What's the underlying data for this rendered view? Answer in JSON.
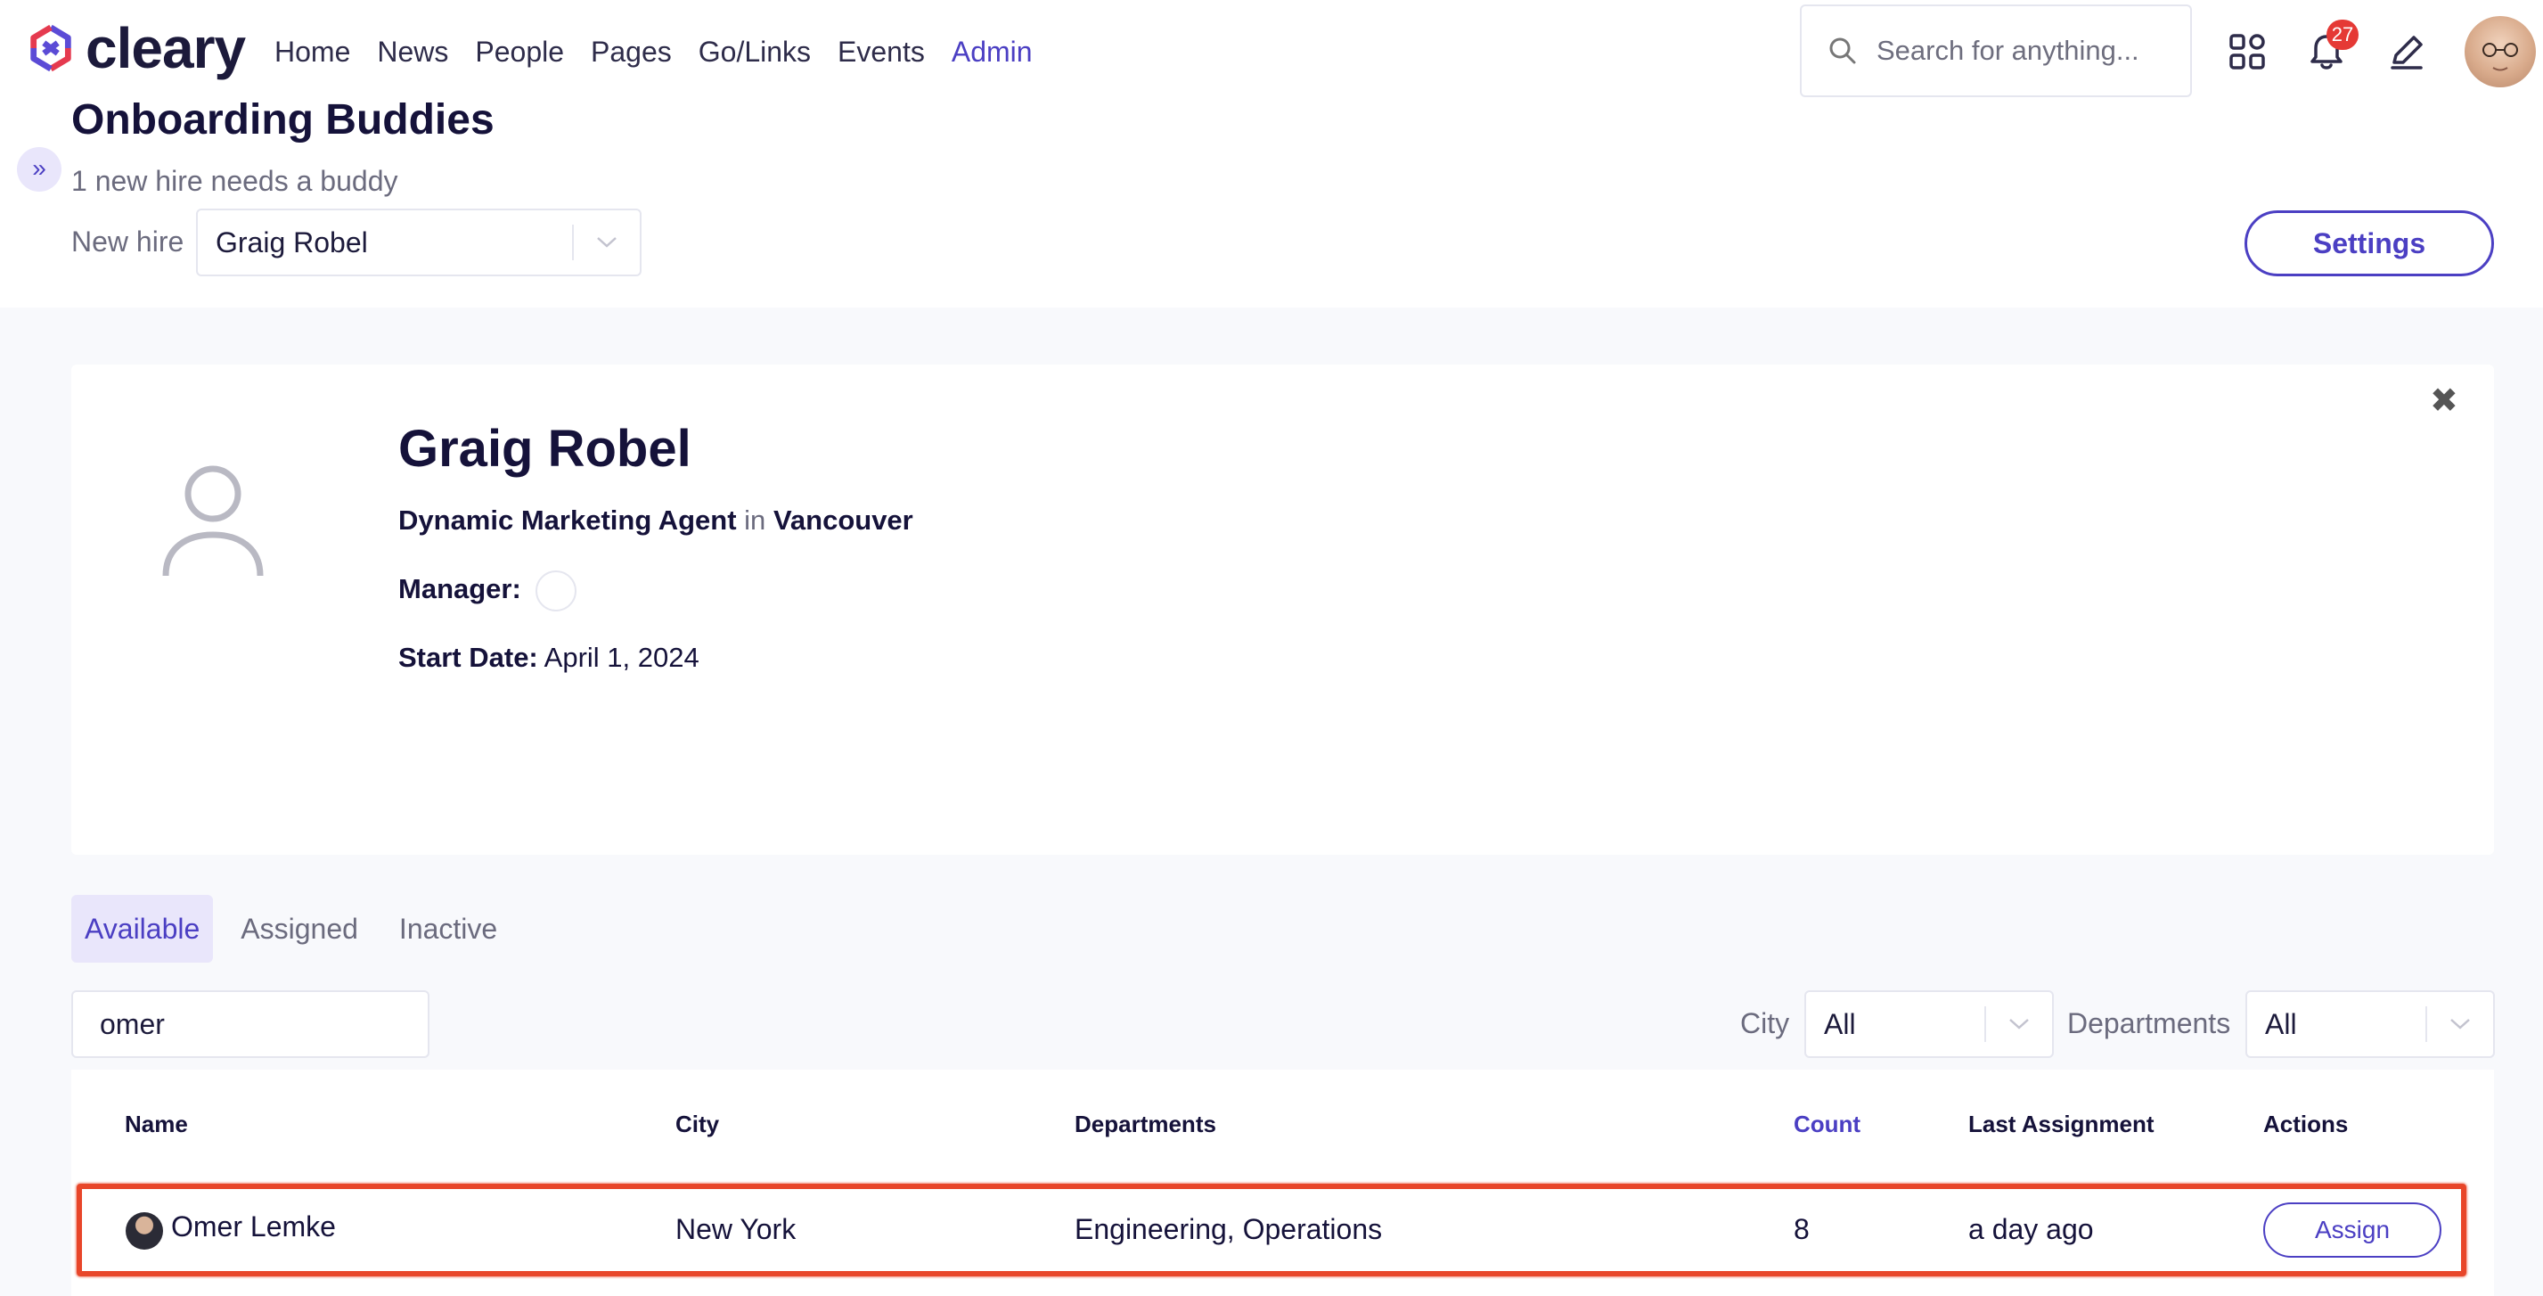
{
  "app": {
    "logo_text": "cleary"
  },
  "nav": {
    "items": [
      "Home",
      "News",
      "People",
      "Pages",
      "Go/Links",
      "Events",
      "Admin"
    ],
    "active": "Admin"
  },
  "header": {
    "search_placeholder": "Search for anything...",
    "notification_count": "27",
    "icons": [
      "apps-grid-icon",
      "bell-icon",
      "pencil-icon",
      "user-avatar"
    ]
  },
  "page": {
    "title": "Onboarding Buddies",
    "subtitle": "1 new hire needs a buddy",
    "new_hire_label": "New hire",
    "new_hire_selected": "Graig Robel",
    "settings_label": "Settings"
  },
  "new_hire": {
    "name": "Graig Robel",
    "title": "Dynamic Marketing Agent",
    "in_word": "in",
    "location": "Vancouver",
    "manager_label": "Manager:",
    "start_date_label": "Start Date:",
    "start_date": "April 1, 2024",
    "close_glyph": "✖"
  },
  "tabs": {
    "items": [
      "Available",
      "Assigned",
      "Inactive"
    ],
    "active": "Available"
  },
  "filters": {
    "search_value": "omer",
    "city_label": "City",
    "city_value": "All",
    "departments_label": "Departments",
    "departments_value": "All"
  },
  "table": {
    "headers": {
      "name": "Name",
      "city": "City",
      "departments": "Departments",
      "count": "Count",
      "last_assignment": "Last Assignment",
      "actions": "Actions"
    },
    "rows": [
      {
        "name": "Omer Lemke",
        "city": "New York",
        "departments": "Engineering, Operations",
        "count": "8",
        "last_assignment": "a day ago",
        "action": "Assign"
      }
    ]
  },
  "colors": {
    "accent": "#4b3fc3",
    "highlight": "#e8462a",
    "badge": "#e53935"
  }
}
